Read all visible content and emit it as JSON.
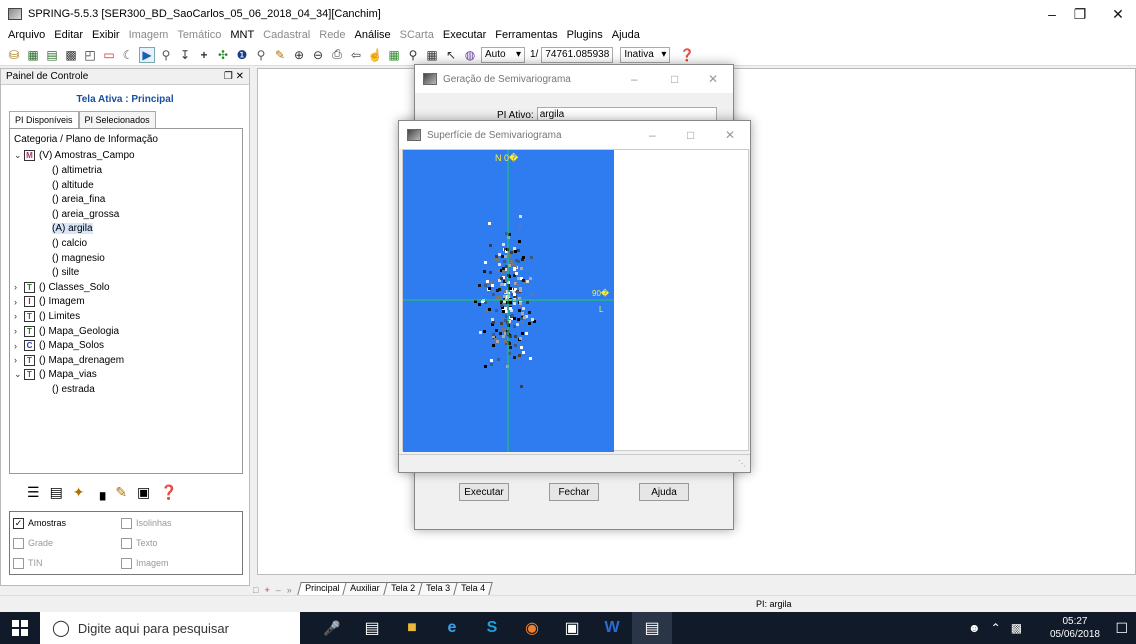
{
  "window": {
    "title": "SPRING-5.5.3 [SER300_BD_SaoCarlos_05_06_2018_04_34][Canchim]"
  },
  "menu": [
    {
      "label": "Arquivo",
      "enabled": true
    },
    {
      "label": "Editar",
      "enabled": true
    },
    {
      "label": "Exibir",
      "enabled": true
    },
    {
      "label": "Imagem",
      "enabled": false
    },
    {
      "label": "Temático",
      "enabled": false
    },
    {
      "label": "MNT",
      "enabled": true
    },
    {
      "label": "Cadastral",
      "enabled": false
    },
    {
      "label": "Rede",
      "enabled": false
    },
    {
      "label": "Análise",
      "enabled": true
    },
    {
      "label": "SCarta",
      "enabled": false
    },
    {
      "label": "Executar",
      "enabled": true
    },
    {
      "label": "Ferramentas",
      "enabled": true
    },
    {
      "label": "Plugins",
      "enabled": true
    },
    {
      "label": "Ajuda",
      "enabled": true
    }
  ],
  "toolbar": {
    "mode": "Auto",
    "scale_prefix": "1/",
    "scale": "74761.085938",
    "state": "Inativa"
  },
  "panel": {
    "title": "Painel de Controle",
    "active_screen": "Tela Ativa : Principal",
    "tabs": [
      "PI Disponíveis",
      "PI Selecionados"
    ],
    "tree_header": "Categoria / Plano de Informação",
    "tree": [
      {
        "type": "cat",
        "badge": "M",
        "label": "(V) Amostras_Campo",
        "open": true
      },
      {
        "type": "leaf",
        "label": "() altimetria"
      },
      {
        "type": "leaf",
        "label": "() altitude"
      },
      {
        "type": "leaf",
        "label": "() areia_fina"
      },
      {
        "type": "leaf",
        "label": "() areia_grossa"
      },
      {
        "type": "leaf",
        "label": "(A) argila",
        "selected": true
      },
      {
        "type": "leaf",
        "label": "() calcio"
      },
      {
        "type": "leaf",
        "label": "() magnesio"
      },
      {
        "type": "leaf",
        "label": "() silte"
      },
      {
        "type": "cat",
        "badge": "T",
        "label": "() Classes_Solo",
        "open": false
      },
      {
        "type": "cat",
        "badge": "I",
        "label": "() Imagem",
        "open": false
      },
      {
        "type": "cat",
        "badge": "T",
        "label": "() Limites",
        "open": false
      },
      {
        "type": "cat",
        "badge": "T",
        "label": "() Mapa_Geologia",
        "open": false
      },
      {
        "type": "cat",
        "badge": "C",
        "label": "() Mapa_Solos",
        "open": false
      },
      {
        "type": "cat",
        "badge": "T",
        "label": "() Mapa_drenagem",
        "open": false
      },
      {
        "type": "cat",
        "badge": "T",
        "label": "() Mapa_vias",
        "open": true
      },
      {
        "type": "leaf",
        "label": "() estrada"
      }
    ],
    "checks": [
      {
        "label": "Amostras",
        "checked": true
      },
      {
        "label": "Isolinhas",
        "checked": false
      },
      {
        "label": "Grade",
        "checked": false
      },
      {
        "label": "Texto",
        "checked": false
      },
      {
        "label": "TIN",
        "checked": false
      },
      {
        "label": "Imagem",
        "checked": false
      }
    ]
  },
  "screen_tabs": [
    "Principal",
    "Auxiliar",
    "Tela 2",
    "Tela 3",
    "Tela 4"
  ],
  "status": {
    "pi": "PI: argila"
  },
  "geracao": {
    "title": "Geração de Semivariograma",
    "pi_label": "PI Ativo:",
    "pi_value": "argila",
    "execute": "Executar",
    "close": "Fechar",
    "help": "Ajuda"
  },
  "superficie": {
    "title": "Superfície de Semivariograma",
    "north_label": "N 0�",
    "east_label": "90�",
    "l_label": "L",
    "colors": {
      "bg": "#2f7cf0",
      "axis": "#22cc55",
      "label": "#ffee33"
    }
  },
  "taskbar": {
    "search_placeholder": "Digite aqui para pesquisar",
    "time": "05:27",
    "date": "05/06/2018"
  }
}
